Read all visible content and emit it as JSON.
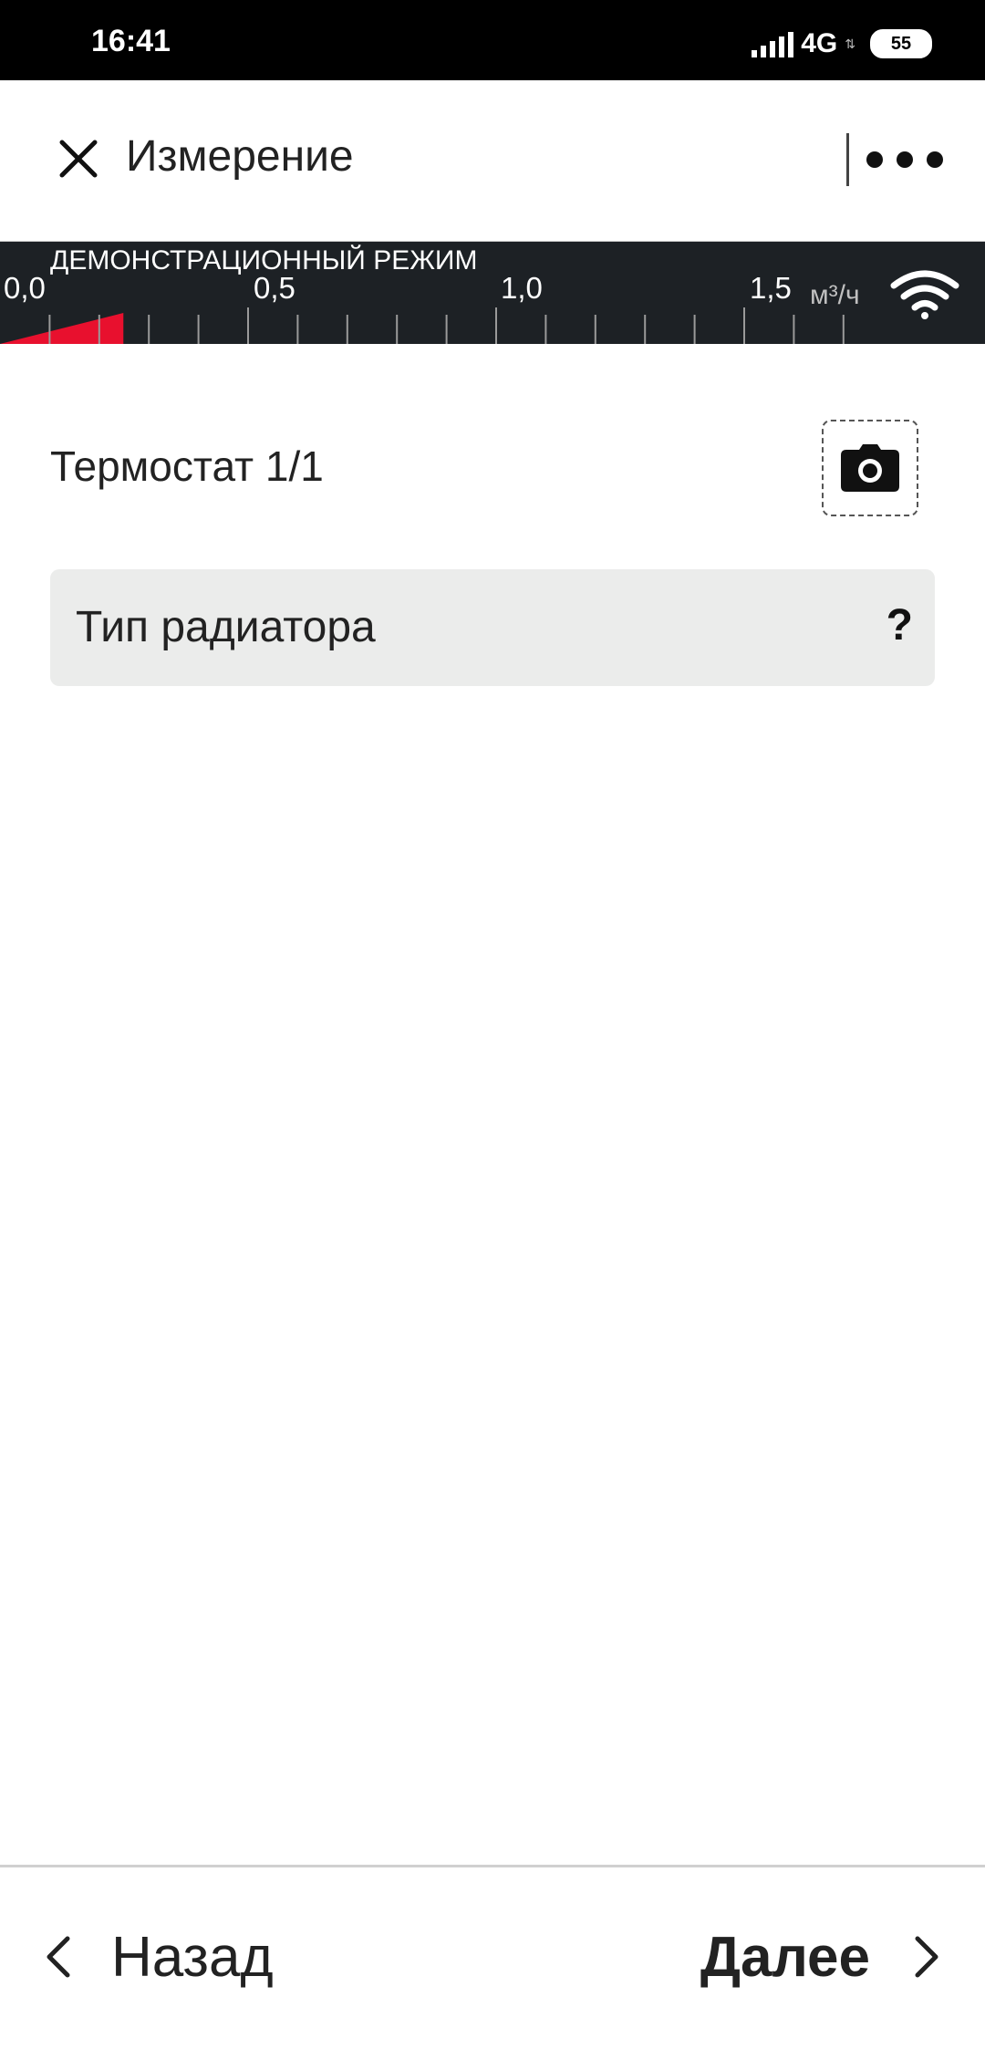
{
  "status_bar": {
    "time": "16:41",
    "network": "4G",
    "battery": "55"
  },
  "app_bar": {
    "title": "Измерение"
  },
  "gauge": {
    "demo_mode_label": "ДЕМОНСТРАЦИОННЫЙ РЕЖИМ",
    "tick_labels": [
      "0,0",
      "0,5",
      "1,0",
      "1,5"
    ],
    "unit": "м³/ч",
    "current_value": 0.12,
    "indicator_color": "#e8102e"
  },
  "content": {
    "thermostat_label": "Термостат 1/1",
    "radiator_field_label": "Тип радиатора",
    "help_symbol": "?"
  },
  "navigation": {
    "back_label": "Назад",
    "next_label": "Далее"
  }
}
